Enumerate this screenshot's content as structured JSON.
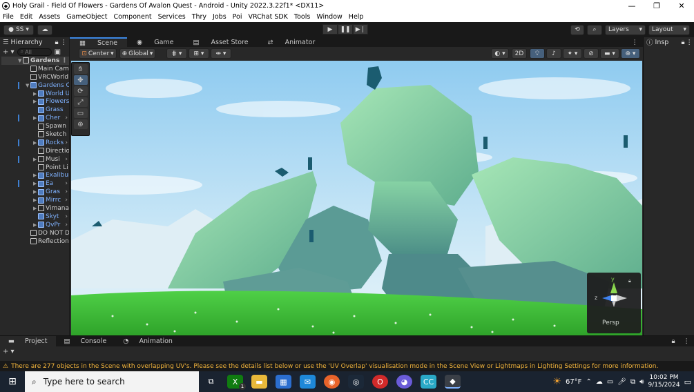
{
  "window": {
    "title": "Holy Grail - Field Of Flowers - Gardens Of Avalon Quest - Android - Unity 2022.3.22f1* <DX11>",
    "controls": [
      "—",
      "❐",
      "✕"
    ]
  },
  "menu": [
    "File",
    "Edit",
    "Assets",
    "GameObject",
    "Component",
    "Services",
    "Thry",
    "Jobs",
    "Poi",
    "VRChat SDK",
    "Tools",
    "Window",
    "Help"
  ],
  "toolbar": {
    "account": "SS",
    "layers": "Layers",
    "layout": "Layout"
  },
  "hierarchy": {
    "tab": "Hierarchy",
    "search_placeholder": "All",
    "rows": [
      "Gardens",
      "Main Cam",
      "VRCWorld",
      "Gardens C",
      "World U",
      "Flowers",
      "Grass",
      "Cher",
      "Spawn",
      "Sketch",
      "Rocks",
      "Directio",
      "Musi",
      "Point Li",
      "Exalibur",
      "Ea",
      "Gras",
      "Mirrc",
      "Vimana",
      "Skyt",
      "QvPr",
      "DO NOT D",
      "Reflection"
    ]
  },
  "scene": {
    "tabs": [
      "Scene",
      "Game",
      "Asset Store",
      "Animator"
    ],
    "pivot": "Center",
    "space": "Global",
    "mode_2d": "2D",
    "gizmo": {
      "y": "y",
      "z": "z",
      "persp": "Persp"
    }
  },
  "inspector": {
    "tab": "Insp"
  },
  "bottom": {
    "tabs": [
      "Project",
      "Console",
      "Animation"
    ]
  },
  "warning": "There are 277 objects in the Scene with overlapping UV's. Please see the details list below or use the 'UV Overlap' visualisation mode in the Scene View or Lightmaps in Lighting Settings for more information.",
  "taskbar": {
    "search_placeholder": "Type here to search",
    "temperature": "67°F",
    "time": "10:02 PM",
    "date": "9/15/2024",
    "xbox_badge": "1"
  },
  "colors": {
    "accent": "#3d89e6",
    "warning": "#f2b43c",
    "prefab": "#7fb2ff"
  }
}
